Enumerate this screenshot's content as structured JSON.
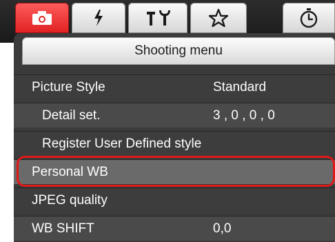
{
  "tabs": [
    {
      "name": "shooting",
      "icon": "camera-icon",
      "active": true
    },
    {
      "name": "playback",
      "icon": "lightning-icon",
      "active": false
    },
    {
      "name": "setup",
      "icon": "tools-icon",
      "active": false
    },
    {
      "name": "my-menu",
      "icon": "star-icon",
      "active": false
    },
    {
      "name": "timer",
      "icon": "stopwatch-icon",
      "active": false
    }
  ],
  "menu": {
    "title": "Shooting menu",
    "rows": [
      {
        "label": "Picture Style",
        "value": "Standard"
      },
      {
        "label": "Detail set.",
        "value": "3 , 0 , 0 , 0"
      },
      {
        "label": "Register User Defined style",
        "value": ""
      },
      {
        "label": "Personal WB",
        "value": ""
      },
      {
        "label": "JPEG quality",
        "value": ""
      },
      {
        "label": "WB SHIFT",
        "value": "0,0"
      }
    ]
  },
  "colors": {
    "active_tab": "#e02121",
    "highlight_border": "#e01818",
    "panel_bg": "#3b3b3b"
  }
}
